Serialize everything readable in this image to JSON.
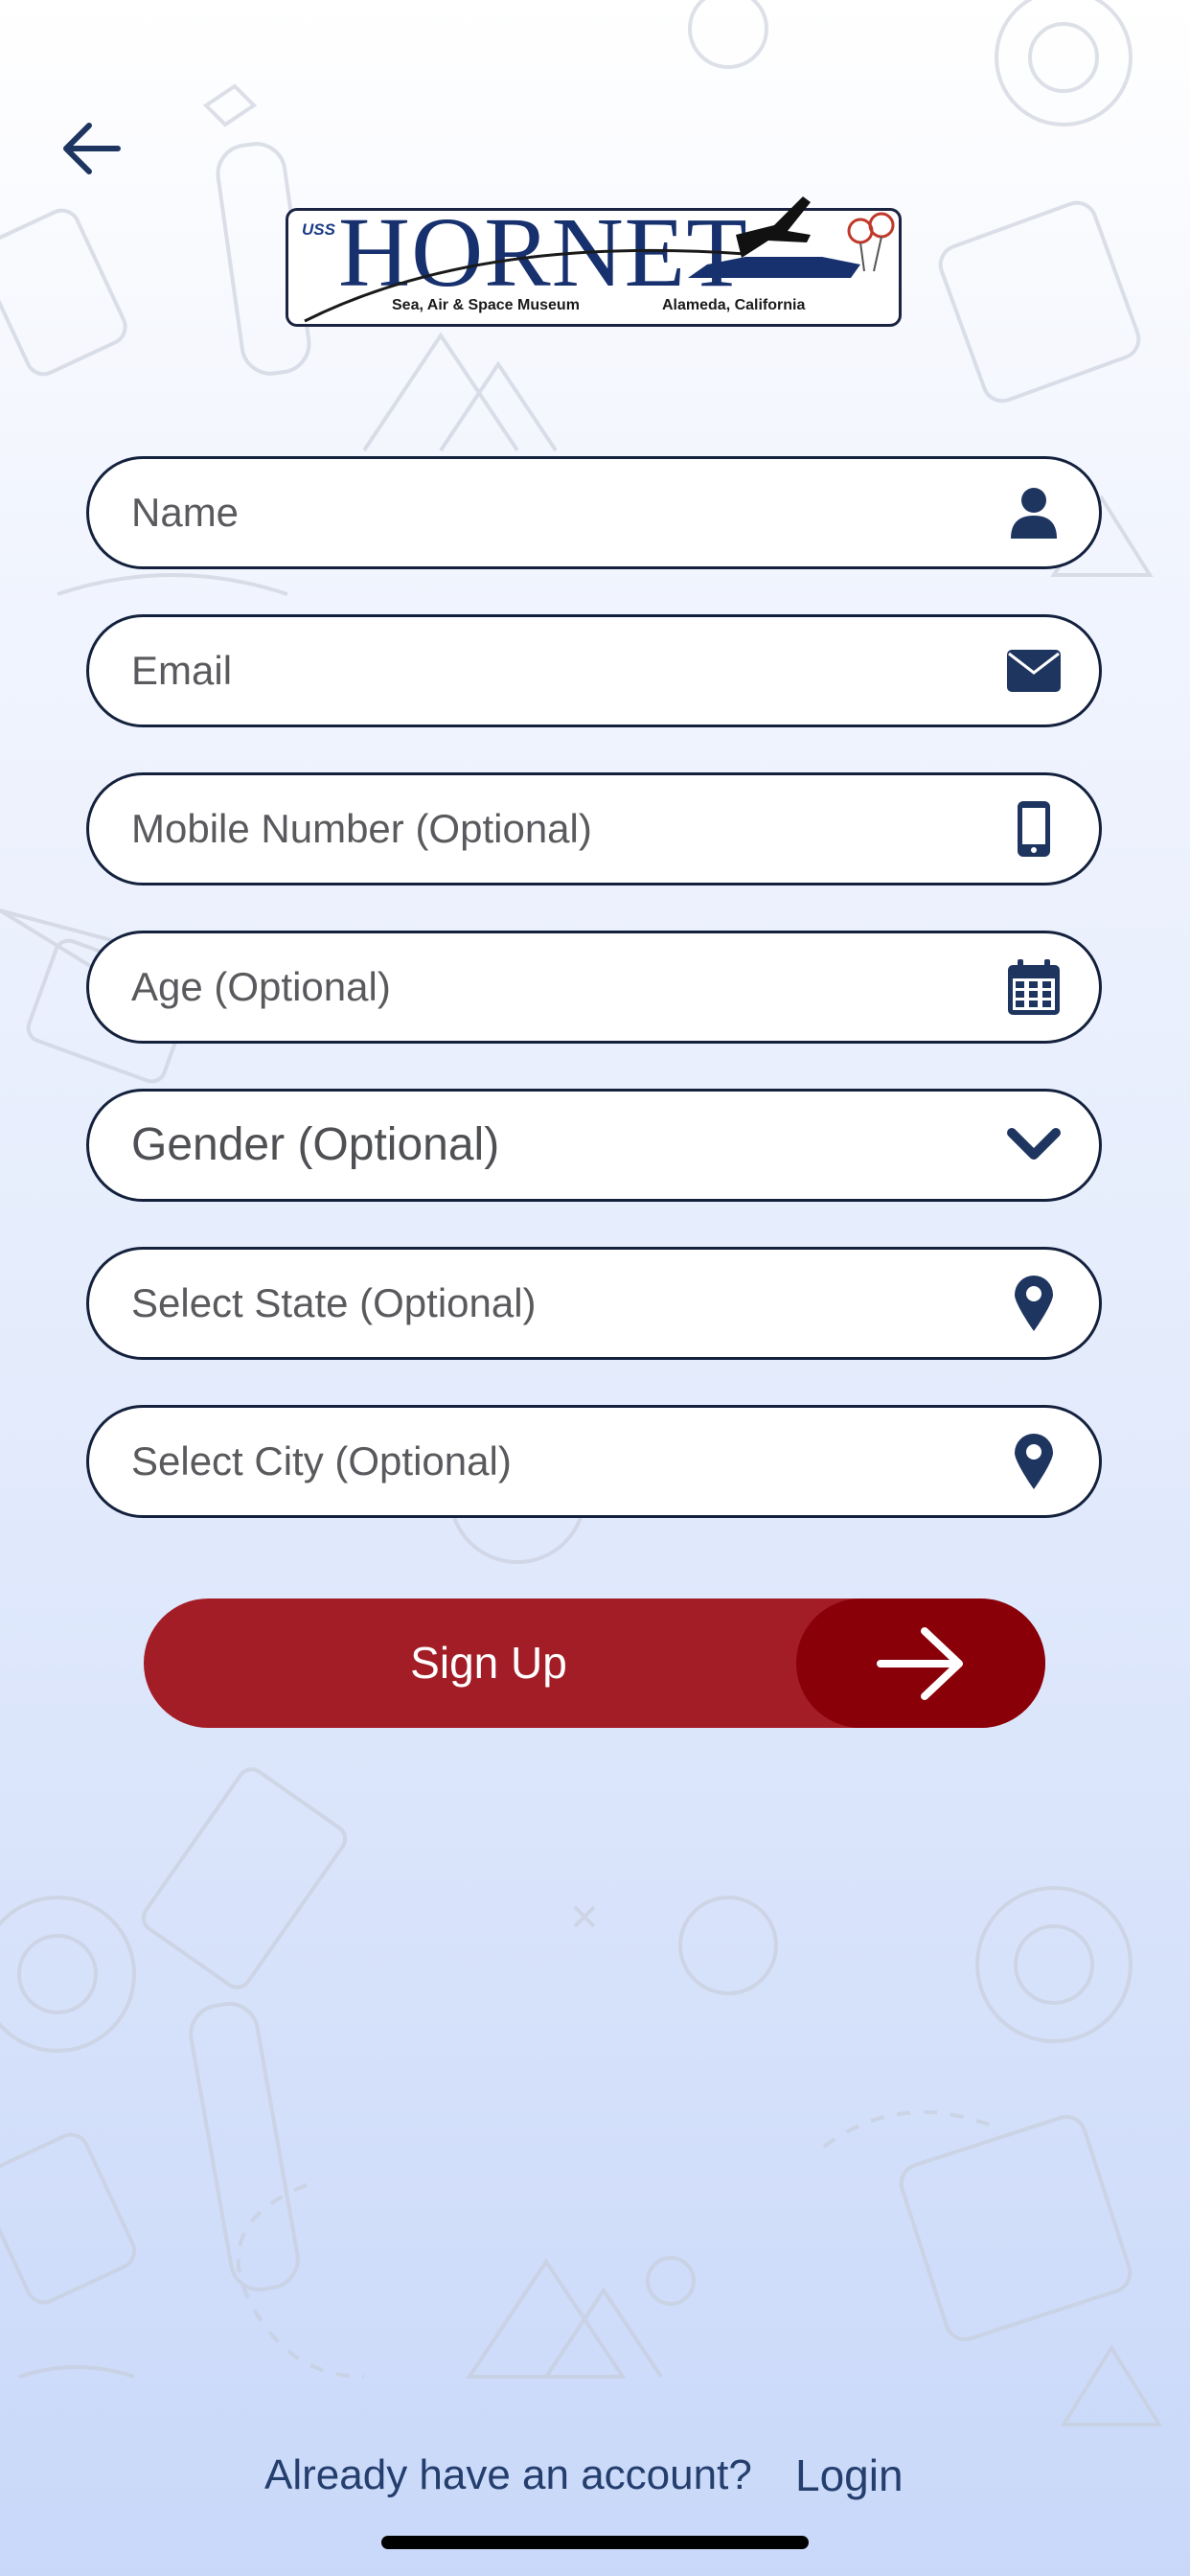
{
  "logo": {
    "prefix": "USS",
    "name": "HORNET",
    "tagline_left": "Sea, Air & Space Museum",
    "tagline_right": "Alameda, California"
  },
  "form": {
    "fields": [
      {
        "placeholder": "Name",
        "icon": "user-icon"
      },
      {
        "placeholder": "Email",
        "icon": "envelope-icon"
      },
      {
        "placeholder": "Mobile Number (Optional)",
        "icon": "mobile-phone-icon"
      },
      {
        "placeholder": "Age (Optional)",
        "icon": "calendar-icon"
      },
      {
        "placeholder": "Gender (Optional)",
        "icon": "chevron-down-icon"
      },
      {
        "placeholder": "Select State (Optional)",
        "icon": "map-pin-icon"
      },
      {
        "placeholder": "Select City (Optional)",
        "icon": "map-pin-icon"
      }
    ],
    "submit_label": "Sign Up"
  },
  "footer": {
    "question": "Already have an account?",
    "login_label": "Login"
  },
  "colors": {
    "navy": "#14213d",
    "button_red": "#a31d27",
    "button_dark_red": "#8a0008",
    "link_blue": "#243e6e"
  }
}
